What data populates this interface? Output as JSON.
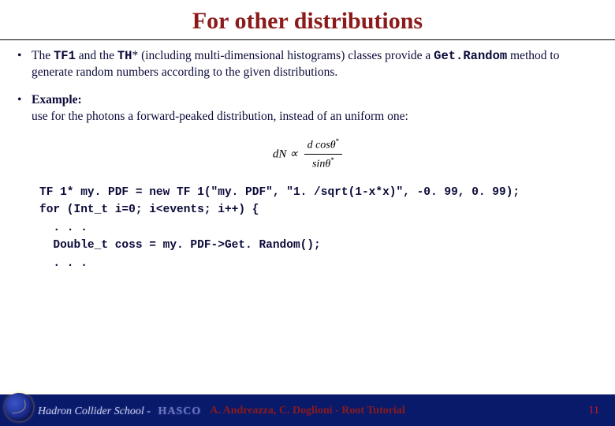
{
  "title": "For other distributions",
  "bullets": [
    {
      "pre": "The ",
      "tf1": "TF1",
      "mid1": " and the ",
      "th": "TH",
      "mid2": "* (including multi-dimensional histograms) classes provide a ",
      "method": "Get.Random",
      "post": " method to generate random numbers according to the given distributions."
    },
    {
      "label": "Example:",
      "text": "use for the photons a forward-peaked distribution, instead of an uniform one:"
    }
  ],
  "formula": {
    "lhs": "dN ∝",
    "num_a": "d cos",
    "num_theta": "θ",
    "num_sup": "*",
    "den_a": "sin",
    "den_theta": "θ",
    "den_sup": "*"
  },
  "code": "TF 1* my. PDF = new TF 1(\"my. PDF\", \"1. /sqrt(1-x*x)\", -0. 99, 0. 99);\nfor (Int_t i=0; i<events; i++) {\n  . . .\n  Double_t coss = my. PDF->Get. Random();\n  . . .",
  "footer": {
    "left_a": "Hadron Collider School -",
    "left_b": "HASCO",
    "center": "A. Andreazza, C. Doglioni - Root Tutorial",
    "page": "11"
  }
}
